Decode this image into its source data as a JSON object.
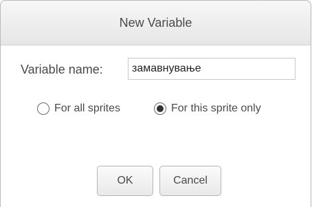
{
  "dialog": {
    "title": "New Variable",
    "variable_name_label": "Variable name:",
    "variable_name_value": "замавнување",
    "scope_options": [
      {
        "label": "For all sprites",
        "selected": false
      },
      {
        "label": "For this sprite only",
        "selected": true
      }
    ],
    "ok_label": "OK",
    "cancel_label": "Cancel"
  }
}
